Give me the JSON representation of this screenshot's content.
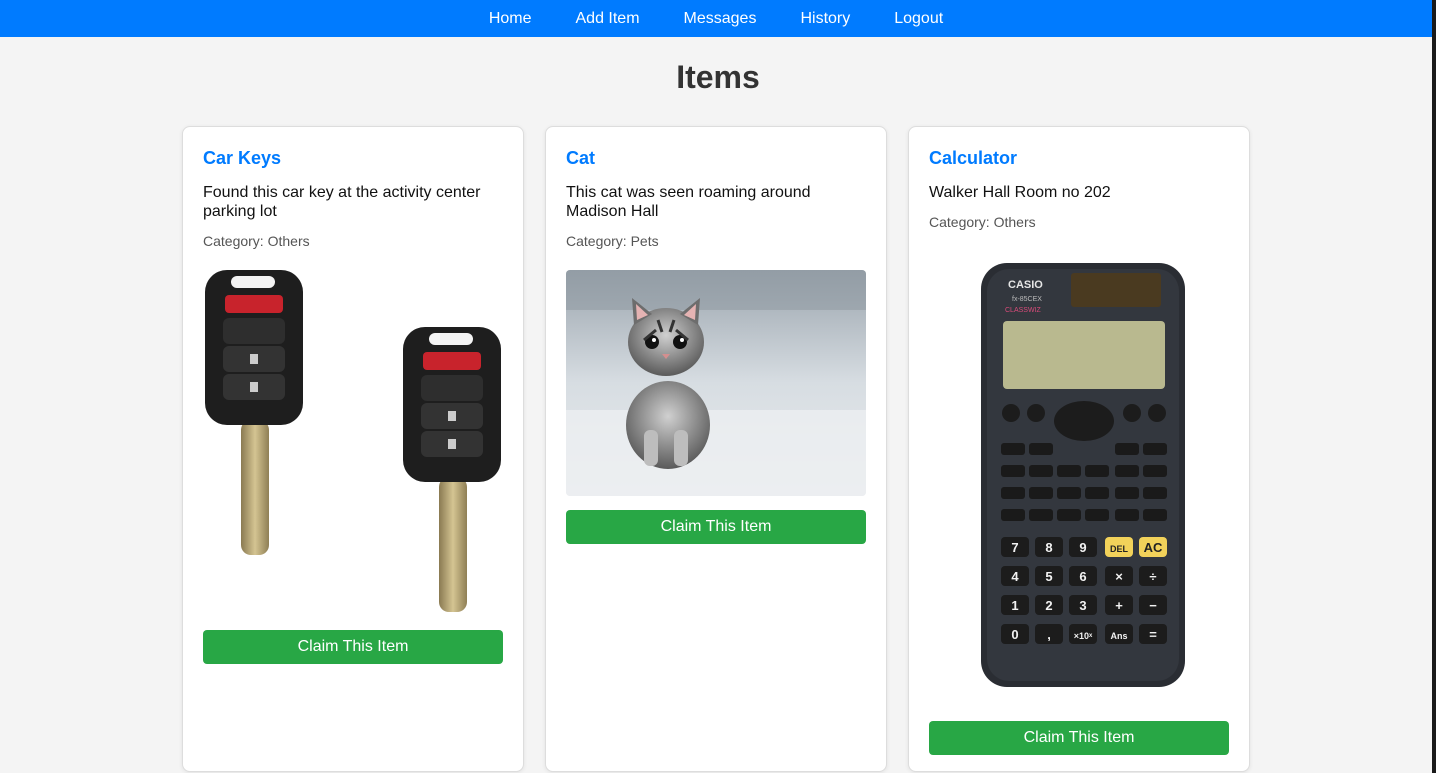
{
  "nav": {
    "items": [
      "Home",
      "Add Item",
      "Messages",
      "History",
      "Logout"
    ]
  },
  "page": {
    "title": "Items"
  },
  "items": [
    {
      "title": "Car Keys",
      "description": "Found this car key at the activity center parking lot",
      "category": "Category: Others",
      "claim_label": "Claim This Item",
      "image_icon": "car-keys-photo"
    },
    {
      "title": "Cat",
      "description": "This cat was seen roaming around Madison Hall",
      "category": "Category: Pets",
      "claim_label": "Claim This Item",
      "image_icon": "kitten-photo"
    },
    {
      "title": "Calculator",
      "description": "Walker Hall Room no 202",
      "category": "Category: Others",
      "claim_label": "Claim This Item",
      "image_icon": "calculator-photo"
    }
  ],
  "calculator_photo": {
    "brand": "CASIO",
    "model": "fx-85CEX",
    "series": "CLASSWIZ",
    "keys": [
      "7",
      "8",
      "9",
      "DEL",
      "AC",
      "4",
      "5",
      "6",
      "×",
      "÷",
      "1",
      "2",
      "3",
      "+",
      "−",
      "0",
      ",",
      "×10ˣ",
      "Ans",
      "="
    ]
  },
  "colors": {
    "nav": "#007bff",
    "title_link": "#007bff",
    "claim_button": "#28a745",
    "background": "#f4f4f4"
  }
}
